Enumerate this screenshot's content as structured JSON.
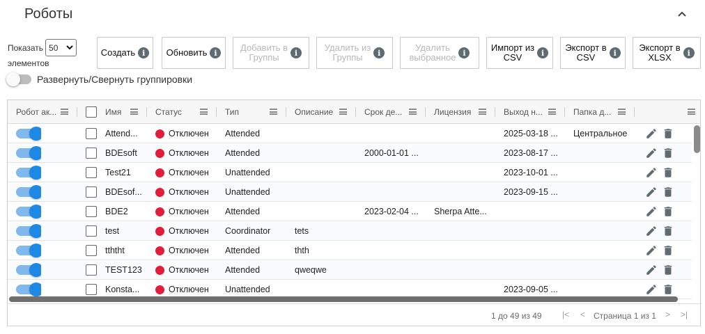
{
  "page": {
    "title": "Роботы"
  },
  "show": {
    "label": "Показать",
    "value": "50",
    "suffix": "элементов"
  },
  "toolbar": {
    "create": "Создать",
    "refresh": "Обновить",
    "add_to_groups_1": "Добавить в",
    "add_to_groups_2": "Группы",
    "remove_from_groups_1": "Удалить из",
    "remove_from_groups_2": "Группы",
    "delete_selected_1": "Удалить",
    "delete_selected_2": "выбранное",
    "import_csv_1": "Импорт из",
    "import_csv_2": "CSV",
    "export_csv_1": "Экспорт в",
    "export_csv_2": "CSV",
    "export_xlsx_1": "Экспорт в",
    "export_xlsx_2": "XLSX",
    "info_glyph": "i"
  },
  "grouping": {
    "label": "Развернуть/Свернуть группировки"
  },
  "grid": {
    "columns": [
      "Робот ак...",
      "Имя",
      "Статус",
      "Тип",
      "Описание",
      "Срок де...",
      "Лицензия",
      "Выход н...",
      "Папка д..."
    ],
    "rows": [
      {
        "name": "Attend...",
        "status": "Отключен",
        "type": "Attended",
        "description": "",
        "expiry": "",
        "license": "",
        "last_logout": "2025-03-18 ...",
        "folder": "Центральное"
      },
      {
        "name": "BDEsoft",
        "status": "Отключен",
        "type": "Attended",
        "description": "",
        "expiry": "2000-01-01 ...",
        "license": "",
        "last_logout": "2023-08-17 ...",
        "folder": ""
      },
      {
        "name": "Test21",
        "status": "Отключен",
        "type": "Unattended",
        "description": "",
        "expiry": "",
        "license": "",
        "last_logout": "2023-10-01 ...",
        "folder": ""
      },
      {
        "name": "BDEsof...",
        "status": "Отключен",
        "type": "Unattended",
        "description": "",
        "expiry": "",
        "license": "",
        "last_logout": "2023-09-15 ...",
        "folder": ""
      },
      {
        "name": "BDE2",
        "status": "Отключен",
        "type": "Attended",
        "description": "",
        "expiry": "2023-02-04 ...",
        "license": "Sherpa Atte...",
        "last_logout": "",
        "folder": ""
      },
      {
        "name": "test",
        "status": "Отключен",
        "type": "Coordinator",
        "description": "tets",
        "expiry": "",
        "license": "",
        "last_logout": "",
        "folder": ""
      },
      {
        "name": "tththt",
        "status": "Отключен",
        "type": "Attended",
        "description": "thth",
        "expiry": "",
        "license": "",
        "last_logout": "",
        "folder": ""
      },
      {
        "name": "TEST123",
        "status": "Отключен",
        "type": "Attended",
        "description": "qweqwe",
        "expiry": "",
        "license": "",
        "last_logout": "",
        "folder": ""
      },
      {
        "name": "Konsta...",
        "status": "Отключен",
        "type": "Unattended",
        "description": "",
        "expiry": "",
        "license": "",
        "last_logout": "2023-09-05 ...",
        "folder": ""
      }
    ]
  },
  "pagination": {
    "range": "1 до 49 из 49",
    "page_text": "Страница 1 из 1"
  },
  "colors": {
    "accent": "#1e88e5",
    "status_off": "#e01e3c",
    "icon": "#5f6b73"
  }
}
